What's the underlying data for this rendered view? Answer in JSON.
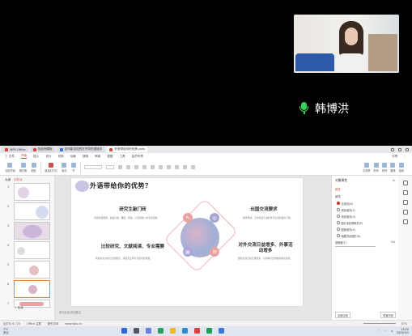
{
  "caller": {
    "name": "韩博洪"
  },
  "wps": {
    "tabs": [
      {
        "label": "WPS Office",
        "color": "#d5433a",
        "active": false
      },
      {
        "label": "找稻壳模板",
        "color": "#d5433a",
        "active": false
      },
      {
        "label": "如何能自如的在不同的语境中",
        "color": "#3b6fd8",
        "active": false
      },
      {
        "label": "外语带给你的优势.pptx",
        "color": "#d5433a",
        "active": true
      }
    ],
    "menu": [
      "三 文件",
      "开始",
      "插入",
      "设计",
      "切换",
      "动画",
      "放映",
      "审阅",
      "视图",
      "工具",
      "会员专享"
    ],
    "menu_active_index": 1,
    "menu_right": [
      "分享",
      "⋮"
    ],
    "ribbon_left": [
      "当前开始",
      "格式刷",
      "粘贴",
      "新建幻灯片",
      "版式",
      "节"
    ],
    "ribbon_right": [
      "文本框",
      "形状",
      "排列",
      "替换",
      "选择"
    ],
    "thumb_tabs": [
      "大纲",
      "幻灯片"
    ],
    "thumb_active": 1,
    "slide_numbers": [
      "1",
      "2",
      "3",
      "4",
      "5",
      "6",
      "7"
    ],
    "add_slide": "+ 新建",
    "slide": {
      "title": "外语带给你的优势？",
      "blocks": [
        {
          "heading": "研究生敲门砖",
          "text": "考研英语要求。英语六级、雅思、托福，以及各类入学考试需求。"
        },
        {
          "heading": "出国交流要求",
          "text": "留学申请、工作签证与海外学习交流的语言门槛。"
        },
        {
          "heading": "比较研究、文献阅读、专业需要",
          "text": "阅读外文文献与比较研究，满足专业学习与研究的需要。"
        },
        {
          "heading": "对外交流日益增多、外事活动增多",
          "text": "国际交流活动日益增多，为外事与合作提供语言优势。"
        }
      ]
    },
    "notes_placeholder": "单击此处添加备注",
    "right_pane": {
      "title": "对象属性",
      "section": "填充",
      "sub": "填充",
      "options": [
        "无填充(N)",
        "纯色填充(S)",
        "渐变填充(G)",
        "图片或纹理填充(P)",
        "图案填充(A)",
        "隐藏背景图形(H)"
      ],
      "selected_option": 0,
      "transparency_label": "透明度(T)",
      "transparency_value": "0%",
      "apply_all": "全部应用",
      "reset": "重置背景"
    },
    "status": {
      "left": "幻灯片 6 / 20",
      "theme": "Office 主题",
      "font": "缺失字体",
      "right_zoom": "37%",
      "office_link": "www.wps.cn"
    },
    "taskbar": {
      "weather_temp": "7°C",
      "weather_text": "多云",
      "time": "13:32",
      "date": "2023/3/1"
    }
  }
}
